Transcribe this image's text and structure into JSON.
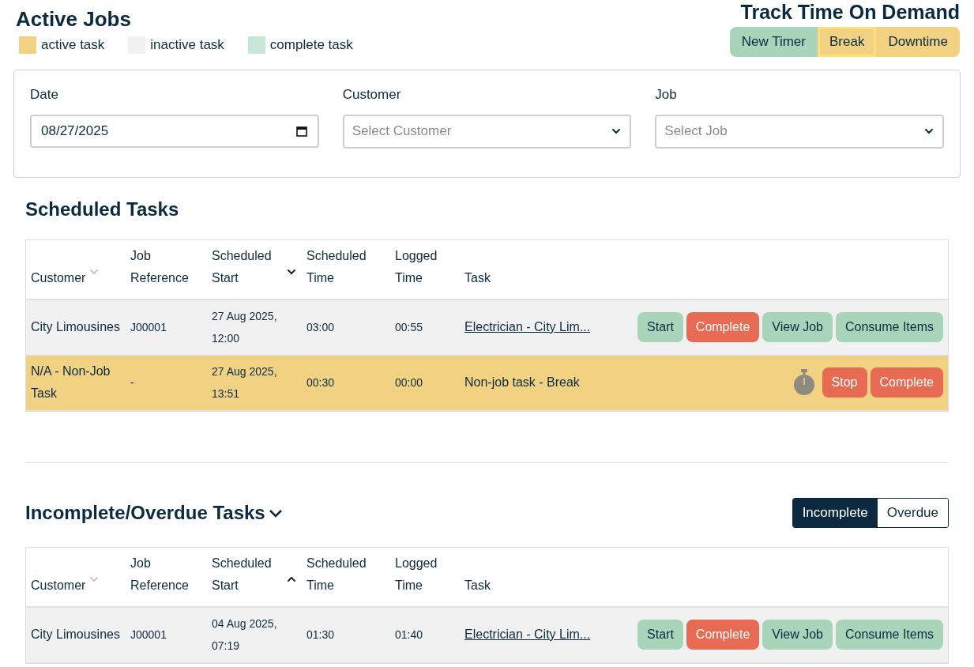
{
  "header": {
    "title": "Active Jobs",
    "legend": [
      {
        "label": "active task",
        "color": "#f0d282"
      },
      {
        "label": "inactive task",
        "color": "#f1f1f1"
      },
      {
        "label": "complete task",
        "color": "#c8e6d6"
      }
    ]
  },
  "on_demand": {
    "title": "Track Time On Demand",
    "buttons": [
      {
        "label": "New Timer",
        "color": "#a8d5ba",
        "selected": false
      },
      {
        "label": "Break",
        "color": "#f0d282",
        "selected": true
      },
      {
        "label": "Downtime",
        "color": "#f0d282",
        "selected": false
      }
    ]
  },
  "filters": {
    "date": {
      "label": "Date",
      "value": "08/27/2025"
    },
    "customer": {
      "label": "Customer",
      "placeholder": "Select Customer"
    },
    "job": {
      "label": "Job",
      "placeholder": "Select Job"
    }
  },
  "scheduled": {
    "title": "Scheduled Tasks",
    "columns": [
      {
        "label": "Customer",
        "sortable": true,
        "sorted": false
      },
      {
        "label": "Job Reference"
      },
      {
        "label": "Scheduled Start",
        "sortable": true,
        "sorted": true,
        "ascending": false
      },
      {
        "label": "Scheduled Time"
      },
      {
        "label": "Logged Time"
      },
      {
        "label": "Task"
      }
    ],
    "rows": [
      {
        "active": false,
        "customer": "City Limousines",
        "job_reference": "J00001",
        "scheduled_start": "27 Aug 2025, 12:00",
        "scheduled_time": "03:00",
        "logged_time": "00:55",
        "task": "Electrician - City Lim...",
        "task_link": true,
        "timer": false,
        "actions": [
          {
            "label": "Start",
            "kind": "go"
          },
          {
            "label": "Complete",
            "kind": "stop"
          },
          {
            "label": "View Job",
            "kind": "go"
          },
          {
            "label": "Consume Items",
            "kind": "go"
          }
        ]
      },
      {
        "active": true,
        "customer": "N/A - Non-Job Task",
        "job_reference": "-",
        "scheduled_start": "27 Aug 2025, 13:51",
        "scheduled_time": "00:30",
        "logged_time": "00:00",
        "task": "Non-job task - Break",
        "task_link": false,
        "timer": true,
        "actions": [
          {
            "label": "Stop",
            "kind": "stop"
          },
          {
            "label": "Complete",
            "kind": "stop"
          }
        ]
      }
    ]
  },
  "incomplete": {
    "title": "Incomplete/Overdue Tasks",
    "expanded": true,
    "toggle": [
      {
        "label": "Incomplete",
        "selected": true
      },
      {
        "label": "Overdue",
        "selected": false
      }
    ],
    "columns": [
      {
        "label": "Customer",
        "sortable": true,
        "sorted": false
      },
      {
        "label": "Job Reference"
      },
      {
        "label": "Scheduled Start",
        "sortable": true,
        "sorted": true,
        "ascending": true
      },
      {
        "label": "Scheduled Time"
      },
      {
        "label": "Logged Time"
      },
      {
        "label": "Task"
      }
    ],
    "rows": [
      {
        "active": false,
        "customer": "City Limousines",
        "job_reference": "J00001",
        "scheduled_start": "04 Aug 2025, 07:19",
        "scheduled_time": "01:30",
        "logged_time": "01:40",
        "task": "Electrician - City Lim...",
        "task_link": true,
        "timer": false,
        "actions": [
          {
            "label": "Start",
            "kind": "go"
          },
          {
            "label": "Complete",
            "kind": "stop"
          },
          {
            "label": "View Job",
            "kind": "go"
          },
          {
            "label": "Consume Items",
            "kind": "go"
          }
        ]
      }
    ]
  }
}
